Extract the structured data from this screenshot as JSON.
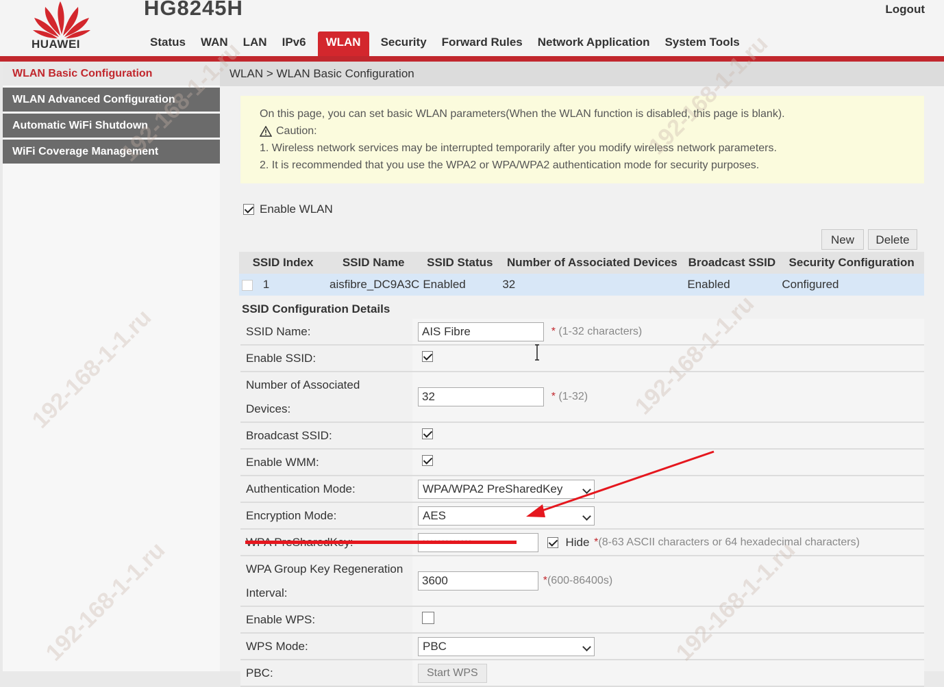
{
  "header": {
    "brand": "HUAWEI",
    "model": "HG8245H",
    "logout": "Logout",
    "brand_color": "#d3272d"
  },
  "nav": {
    "items": [
      {
        "label": "Status"
      },
      {
        "label": "WAN"
      },
      {
        "label": "LAN"
      },
      {
        "label": "IPv6"
      },
      {
        "label": "WLAN",
        "active": true
      },
      {
        "label": "Security"
      },
      {
        "label": "Forward Rules"
      },
      {
        "label": "Network Application"
      },
      {
        "label": "System Tools"
      }
    ]
  },
  "sidebar": {
    "items": [
      {
        "label": "WLAN Basic Configuration",
        "active": true
      },
      {
        "label": "WLAN Advanced Configuration"
      },
      {
        "label": "Automatic WiFi Shutdown"
      },
      {
        "label": "WiFi Coverage Management"
      }
    ]
  },
  "breadcrumb": "WLAN > WLAN Basic Configuration",
  "notice": {
    "intro": "On this page, you can set basic WLAN parameters(When the WLAN function is disabled, this page is blank).",
    "caution_label": "Caution:",
    "line1": "1. Wireless network services may be interrupted temporarily after you modify wireless network parameters.",
    "line2": "2. It is recommended that you use the WPA2 or WPA/WPA2 authentication mode for security purposes."
  },
  "enable_wlan": {
    "label": "Enable WLAN",
    "checked": true
  },
  "buttons": {
    "new": "New",
    "delete": "Delete"
  },
  "ssid_table": {
    "headers": [
      "SSID Index",
      "SSID Name",
      "SSID Status",
      "Number of Associated Devices",
      "Broadcast SSID",
      "Security Configuration"
    ],
    "rows": [
      {
        "index": "1",
        "name": "aisfibre_DC9A3C",
        "status": "Enabled",
        "devices": "32",
        "broadcast": "Enabled",
        "security": "Configured"
      }
    ]
  },
  "details": {
    "title": "SSID Configuration Details",
    "ssid_name": {
      "label": "SSID Name:",
      "value": "AIS Fibre",
      "hint": "(1-32 characters)"
    },
    "enable_ssid": {
      "label": "Enable SSID:",
      "checked": true
    },
    "assoc_devices": {
      "label_line1": "Number of Associated",
      "label_line2": "Devices:",
      "value": "32",
      "hint": "(1-32)"
    },
    "broadcast_ssid": {
      "label": "Broadcast SSID:",
      "checked": true
    },
    "enable_wmm": {
      "label": "Enable WMM:",
      "checked": true
    },
    "auth_mode": {
      "label": "Authentication Mode:",
      "value": "WPA/WPA2 PreSharedKey"
    },
    "encryption_mode": {
      "label": "Encryption Mode:",
      "value": "AES"
    },
    "psk": {
      "label": "WPA PreSharedKey:",
      "value": "•••••••••••••",
      "hide_label": "Hide",
      "hide_checked": true,
      "hint": "(8-63 ASCII characters or 64 hexadecimal characters)"
    },
    "group_key": {
      "label_line1": "WPA Group Key Regeneration",
      "label_line2": "Interval:",
      "value": "3600",
      "hint": "(600-86400s)"
    },
    "enable_wps": {
      "label": "Enable WPS:",
      "checked": false
    },
    "wps_mode": {
      "label": "WPS Mode:",
      "value": "PBC"
    },
    "pbc": {
      "label": "PBC:",
      "button": "Start WPS"
    }
  },
  "watermarks": [
    "192-168-1-1.ru",
    "192-168-1-1.ru",
    "192-168-1-1.ru",
    "192-168-1-1.ru",
    "192-168-1-1.ru",
    "192-168-1-1.ru"
  ]
}
